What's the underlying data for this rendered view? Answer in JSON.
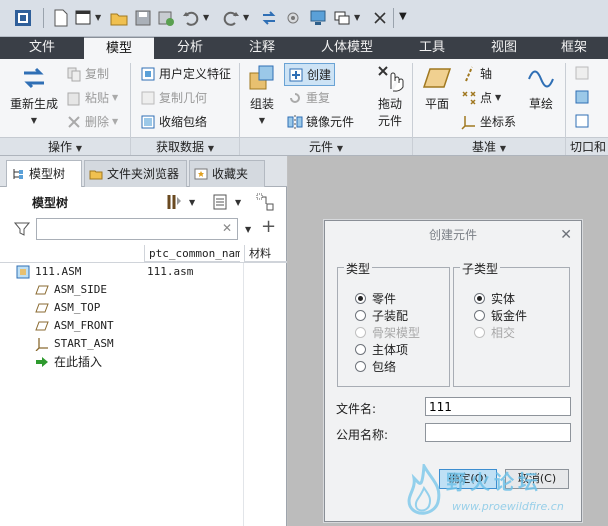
{
  "quick_access": {
    "icons": [
      "window-icon",
      "new-file-icon",
      "open-folder-icon",
      "save-icon",
      "save-copy-icon",
      "undo-icon",
      "redo-icon",
      "regenerate-icon",
      "settings-icon",
      "monitor-icon",
      "windows-icon",
      "close-icon",
      "customize-icon"
    ]
  },
  "ribbon_tabs": [
    "文件",
    "模型",
    "分析",
    "注释",
    "人体模型",
    "工具",
    "视图",
    "框架"
  ],
  "ribbon": {
    "operations": {
      "regenerate": "重新生成",
      "copy": "复制",
      "paste": "粘贴",
      "delete": "删除",
      "footer": "操作"
    },
    "get_data": {
      "udf": "用户定义特征",
      "copy_geom": "复制几何",
      "shrinkwrap": "收缩包络",
      "footer": "获取数据"
    },
    "component": {
      "assemble": "组装",
      "create": "创建",
      "repeat": "重复",
      "mirror": "镜像元件",
      "drag": "拖动",
      "drag2": "元件",
      "footer": "元件"
    },
    "datum": {
      "plane": "平面",
      "axis": "轴",
      "point": "点",
      "csys": "坐标系",
      "sketch": "草绘",
      "footer": "基准"
    },
    "cut": {
      "footer": "切口和"
    }
  },
  "panel": {
    "tabs": [
      "模型树",
      "文件夹浏览器",
      "收藏夹"
    ],
    "title": "模型树",
    "filter_value": "",
    "columns": [
      "ptc_common_name",
      "材料"
    ],
    "rows": [
      {
        "name": "111.ASM",
        "common": "111.asm",
        "icon": "assembly-icon"
      },
      {
        "name": "ASM_SIDE",
        "common": "",
        "icon": "datum-plane-icon"
      },
      {
        "name": "ASM_TOP",
        "common": "",
        "icon": "datum-plane-icon"
      },
      {
        "name": "ASM_FRONT",
        "common": "",
        "icon": "datum-plane-icon"
      },
      {
        "name": "START_ASM",
        "common": "",
        "icon": "csys-icon"
      },
      {
        "name": "在此插入",
        "common": "",
        "icon": "insert-arrow-icon"
      }
    ]
  },
  "dialog": {
    "title": "创建元件",
    "type_legend": "类型",
    "types": [
      {
        "label": "零件",
        "selected": true,
        "disabled": false
      },
      {
        "label": "子装配",
        "selected": false,
        "disabled": false
      },
      {
        "label": "骨架模型",
        "selected": false,
        "disabled": true
      },
      {
        "label": "主体项",
        "selected": false,
        "disabled": false
      },
      {
        "label": "包络",
        "selected": false,
        "disabled": false
      }
    ],
    "subtype_legend": "子类型",
    "subtypes": [
      {
        "label": "实体",
        "selected": true,
        "disabled": false
      },
      {
        "label": "钣金件",
        "selected": false,
        "disabled": false
      },
      {
        "label": "相交",
        "selected": false,
        "disabled": true
      }
    ],
    "filename_label": "文件名:",
    "filename_value": "111",
    "common_label": "公用名称:",
    "common_value": "",
    "ok_label": "确定(O)",
    "cancel_label": "取消(C)"
  },
  "watermark": {
    "text": "野火论坛",
    "url": "www.proewildfire.cn"
  },
  "colors": {
    "tabbar": "#3a3f47",
    "ribbon": "#f5f6f8",
    "accent": "#3d8ed0"
  }
}
